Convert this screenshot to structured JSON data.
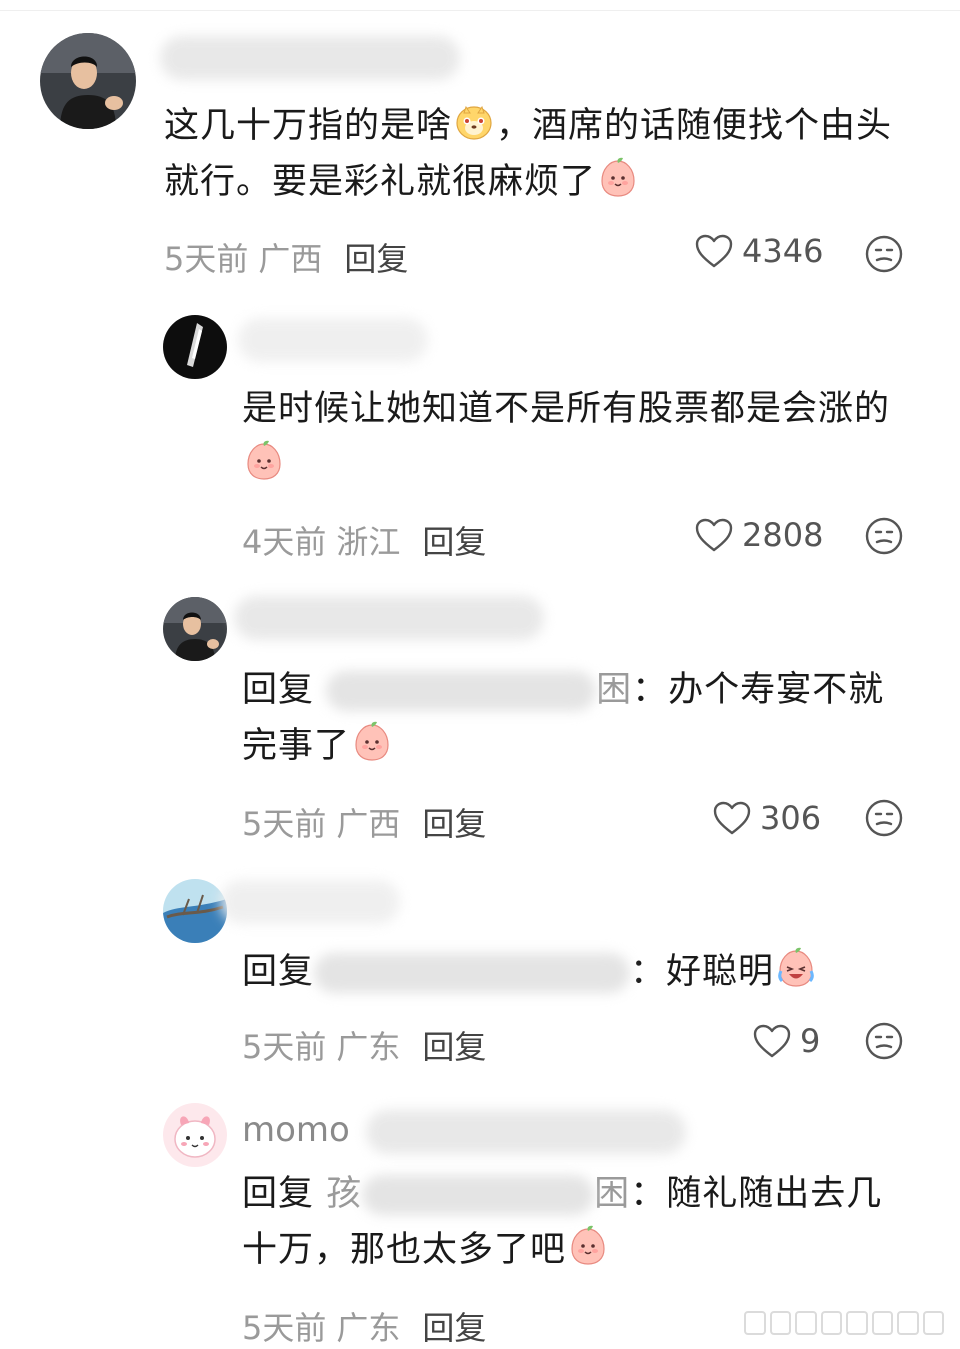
{
  "comments": [
    {
      "text_a": "这几十万指的是啥",
      "text_b": "，酒席的话随便找个由头",
      "text_c": "就行。要是彩礼就很麻烦了",
      "time": "5天前",
      "location": "广西",
      "reply_label": "回复",
      "likes": "4346"
    },
    {
      "text_a": "是时候让她知道不是所有股票都是会涨的",
      "time": "4天前",
      "location": "浙江",
      "reply_label": "回复",
      "likes": "2808"
    },
    {
      "reply_prefix": "回复",
      "target_suffix": "困",
      "text_a": "：办个寿宴不就",
      "text_b": "完事了",
      "time": "5天前",
      "location": "广西",
      "reply_label": "回复",
      "likes": "306"
    },
    {
      "reply_prefix": "回复",
      "text_a": "：好聪明",
      "time": "5天前",
      "location": "广东",
      "reply_label": "回复",
      "likes": "9"
    },
    {
      "username": "momo",
      "reply_prefix": "回复",
      "target_prefix": "孩",
      "target_suffix": "困",
      "text_a": "：随礼随出去几",
      "text_b": "十万，那也太多了吧",
      "time": "5天前",
      "location": "广东",
      "reply_label": "回复"
    }
  ],
  "icons": {
    "like": "heart-outline-icon",
    "more": "neutral-face-icon",
    "emoji_peach": "peach-smile-emoji",
    "emoji_pet": "pet-face-emoji",
    "emoji_laugh": "laugh-tears-emoji"
  }
}
